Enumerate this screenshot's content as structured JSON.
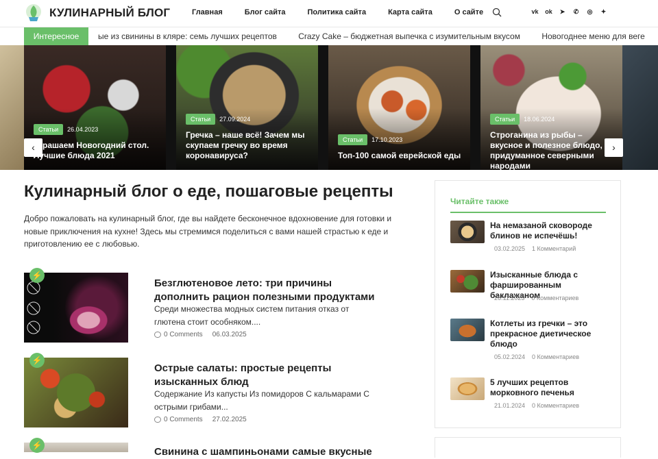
{
  "header": {
    "site_title": "КУЛИНАРНЫЙ БЛОГ",
    "nav": [
      "Главная",
      "Блог сайта",
      "Политика сайта",
      "Карта сайта",
      "О сайте"
    ],
    "socials": [
      "vk-icon",
      "odnoklassniki-icon",
      "telegram-icon",
      "viber-icon",
      "whatsapp-icon",
      "yandex-zen-icon"
    ]
  },
  "ticker": {
    "label": "Интересное",
    "items": [
      "ые из свинины в кляре: семь лучших рецептов",
      "Crazy Cake – бюджетная выпечка с изумительным вкусом",
      "Новогоднее меню для веге"
    ]
  },
  "slider": [
    {
      "tag": "Статьи",
      "date": "26.04.2023",
      "title": "Украшаем Новогодний стол. Лучшие блюда 2021"
    },
    {
      "tag": "Статьи",
      "date": "27.09.2024",
      "title": "Гречка – наше всё! Зачем мы скупаем гречку во время коронавируса?"
    },
    {
      "tag": "Статьи",
      "date": "17.10.2023",
      "title": "Топ-100 самой еврейской еды"
    },
    {
      "tag": "Статьи",
      "date": "18.06.2024",
      "title": "Строганина из рыбы – вкусное и полезное блюдо, придуманное северными народами"
    }
  ],
  "main": {
    "heading": "Кулинарный блог о еде, пошаговые рецепты",
    "intro": "Добро пожаловать на кулинарный блог, где вы найдете бесконечное вдохновение для готовки и новые приключения на кухне! Здесь мы стремимся поделиться с вами нашей страстью к еде и приготовлению ее с любовью.",
    "posts": [
      {
        "title": "Безглютеновое лето: три причины дополнить рацион полезными продуктами",
        "excerpt": "Среди множества модных систем питания отказ от глютена стоит особняком....",
        "comments": "0 Comments",
        "date": "06.03.2025"
      },
      {
        "title": "Острые салаты: простые рецепты изысканных блюд",
        "excerpt": "Содержание Из капусты Из помидоров С кальмарами С острыми грибами...",
        "comments": "0 Comments",
        "date": "27.02.2025"
      },
      {
        "title": "Свинина с шампиньонами самые вкусные"
      }
    ]
  },
  "sidebar": {
    "heading": "Читайте также",
    "items": [
      {
        "title": "На немазаной сковороде блинов не испечёшь!",
        "date": "03.02.2025",
        "comments": "1 Комментарий"
      },
      {
        "title": "Изысканные блюда с фаршированным баклажаном",
        "date": "26.11.2023",
        "comments": "0 Комментариев"
      },
      {
        "title": "Котлеты из гречки – это прекрасное диетическое блюдо",
        "date": "05.02.2024",
        "comments": "0 Комментариев"
      },
      {
        "title": "5 лучших рецептов морковного печенья",
        "date": "21.01.2024",
        "comments": "0 Комментариев"
      }
    ]
  },
  "colors": {
    "accent": "#6abf69"
  }
}
